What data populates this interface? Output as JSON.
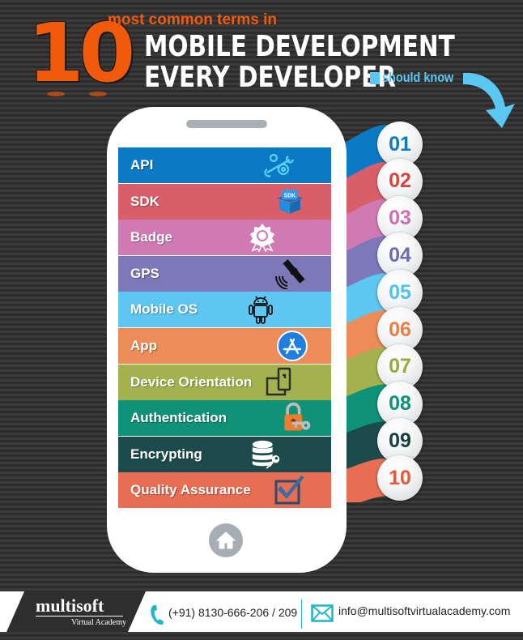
{
  "header": {
    "number": "10",
    "subtitle": "most common terms in",
    "title_line1": "MOBILE DEVELOPMENT",
    "title_line2": "EVERY DEVELOPER",
    "tagline": "should know"
  },
  "terms": [
    {
      "rank": "01",
      "label": "API",
      "icon": "api-gear-wrench-icon",
      "color": "#0b7ac4",
      "num_color": "#0b7ac4"
    },
    {
      "rank": "02",
      "label": "SDK",
      "icon": "sdk-box-icon",
      "color": "#d85f6a",
      "num_color": "#e0413f"
    },
    {
      "rank": "03",
      "label": "Badge",
      "icon": "badge-icon",
      "color": "#d07ab4",
      "num_color": "#cf6fb2"
    },
    {
      "rank": "04",
      "label": "GPS",
      "icon": "satellite-icon",
      "color": "#7d78b8",
      "num_color": "#6f6ab2"
    },
    {
      "rank": "05",
      "label": "Mobile OS",
      "icon": "android-icon",
      "color": "#5dc6f1",
      "num_color": "#4fc2ef"
    },
    {
      "rank": "06",
      "label": "App",
      "icon": "app-store-icon",
      "color": "#ec8c58",
      "num_color": "#ec7e44"
    },
    {
      "rank": "07",
      "label": "Device Orientation",
      "icon": "device-rotation-icon",
      "color": "#a3b24e",
      "num_color": "#98a93d"
    },
    {
      "rank": "08",
      "label": "Authentication",
      "icon": "lock-key-icon",
      "color": "#0f9277",
      "num_color": "#0f9277"
    },
    {
      "rank": "09",
      "label": "Encrypting",
      "icon": "database-key-icon",
      "color": "#1d4b4c",
      "num_color": "#173f40"
    },
    {
      "rank": "10",
      "label": "Quality Assurance",
      "icon": "checkbox-icon",
      "color": "#e76d53",
      "num_color": "#e5583a"
    }
  ],
  "footer": {
    "brand": "multisoft",
    "brand_sub": "Virtual Academy",
    "phone": "(+91) 8130-666-206 / 209",
    "email": "info@multisoftvirtualacademy.com"
  },
  "colors": {
    "accent_orange": "#f05a0a",
    "accent_blue": "#5bc8f3"
  }
}
